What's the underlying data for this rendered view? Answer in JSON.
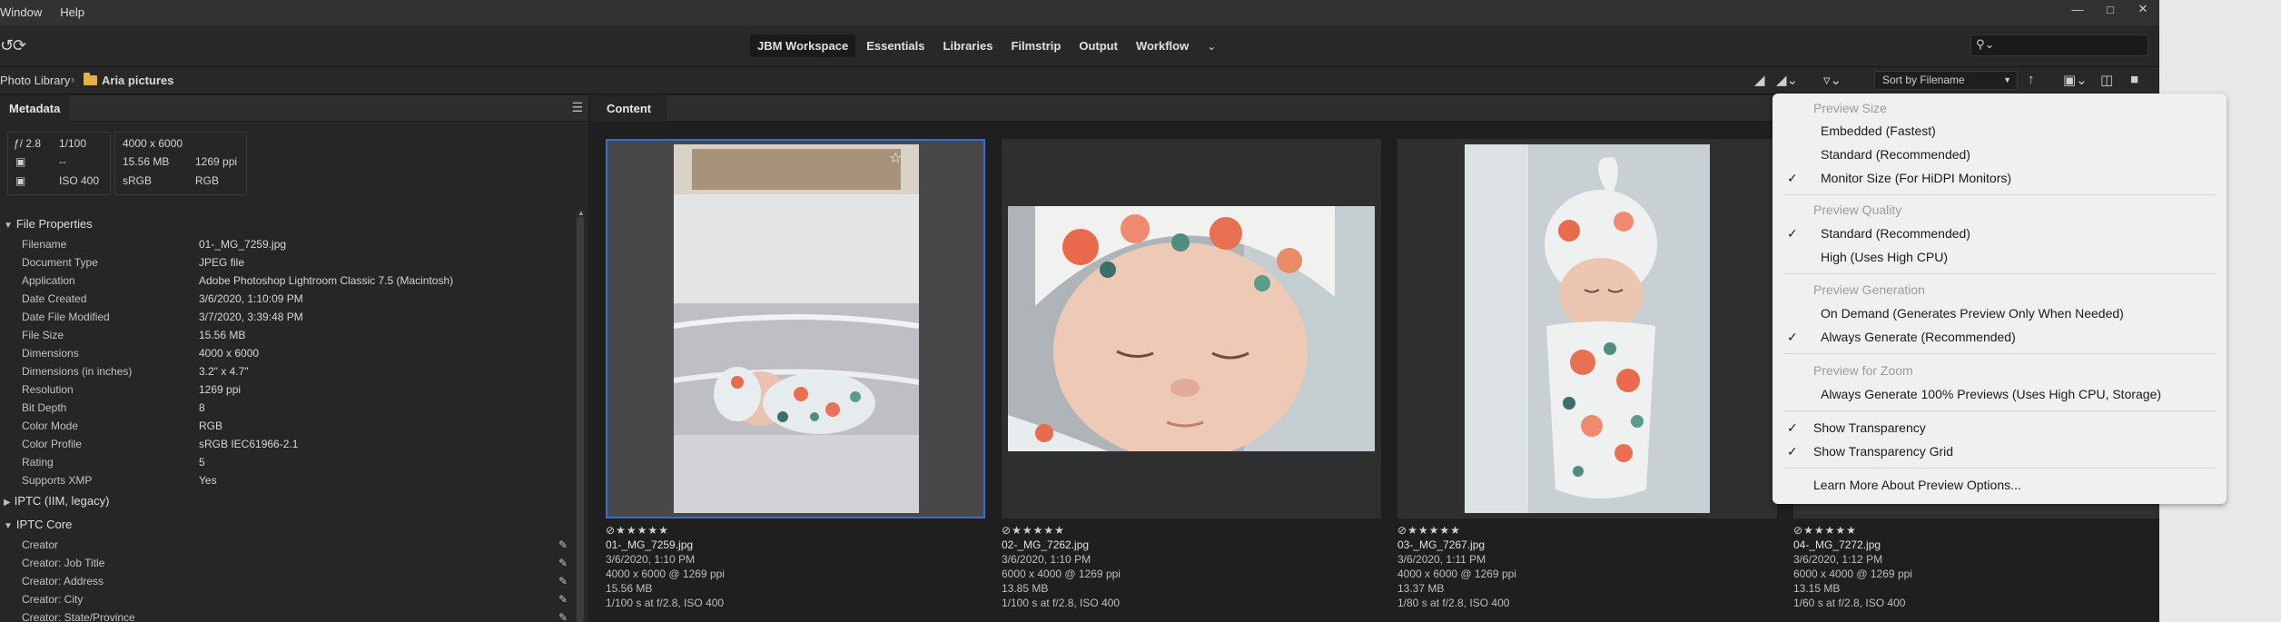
{
  "menu": [
    "Window",
    "Help"
  ],
  "workspaces": [
    "JBM Workspace",
    "Essentials",
    "Libraries",
    "Filmstrip",
    "Output",
    "Workflow"
  ],
  "active_workspace": "JBM Workspace",
  "search": {
    "value": "",
    "placeholder": ""
  },
  "path": {
    "root": "Photo Library",
    "folder": "Aria pictures"
  },
  "sort": {
    "label": "Sort by Filename"
  },
  "metadata_panel": {
    "tab": "Metadata",
    "quick": {
      "aperture": "ƒ/ 2.8",
      "shutter": "1/100",
      "exposure": "--",
      "iso": "ISO 400",
      "dimensions": "4000 x 6000",
      "filesize": "15.56 MB",
      "resolution": "1269 ppi",
      "colorspace": "sRGB",
      "colormode": "RGB"
    },
    "file_properties_title": "File Properties",
    "file_properties": [
      {
        "label": "Filename",
        "value": "01-_MG_7259.jpg"
      },
      {
        "label": "Document Type",
        "value": "JPEG file"
      },
      {
        "label": "Application",
        "value": "Adobe Photoshop Lightroom Classic 7.5 (Macintosh)"
      },
      {
        "label": "Date Created",
        "value": "3/6/2020, 1:10:09 PM"
      },
      {
        "label": "Date File Modified",
        "value": "3/7/2020, 3:39:48 PM"
      },
      {
        "label": "File Size",
        "value": "15.56 MB"
      },
      {
        "label": "Dimensions",
        "value": "4000 x 6000"
      },
      {
        "label": "Dimensions (in inches)",
        "value": "3.2\" x 4.7\""
      },
      {
        "label": "Resolution",
        "value": "1269 ppi"
      },
      {
        "label": "Bit Depth",
        "value": "8"
      },
      {
        "label": "Color Mode",
        "value": "RGB"
      },
      {
        "label": "Color Profile",
        "value": "sRGB IEC61966-2.1"
      },
      {
        "label": "Rating",
        "value": "5"
      },
      {
        "label": "Supports XMP",
        "value": "Yes"
      }
    ],
    "iptc_legacy_title": "IPTC (IIM, legacy)",
    "iptc_core_title": "IPTC Core",
    "iptc_core": [
      "Creator",
      "Creator: Job Title",
      "Creator: Address",
      "Creator: City",
      "Creator: State/Province"
    ]
  },
  "content_panel": {
    "tab": "Content",
    "items": [
      {
        "rating": "★★★★★",
        "name": "01-_MG_7259.jpg",
        "date": "3/6/2020, 1:10 PM",
        "dims": "4000 x 6000 @ 1269 ppi",
        "size": "15.56 MB",
        "exposure": "1/100 s at f/2.8, ISO 400"
      },
      {
        "rating": "★★★★★",
        "name": "02-_MG_7262.jpg",
        "date": "3/6/2020, 1:10 PM",
        "dims": "6000 x 4000 @ 1269 ppi",
        "size": "13.85 MB",
        "exposure": "1/100 s at f/2.8, ISO 400"
      },
      {
        "rating": "★★★★★",
        "name": "03-_MG_7267.jpg",
        "date": "3/6/2020, 1:11 PM",
        "dims": "4000 x 6000 @ 1269 ppi",
        "size": "13.37 MB",
        "exposure": "1/80 s at f/2.8, ISO 400"
      },
      {
        "rating": "★★★★★",
        "name": "04-_MG_7272.jpg",
        "date": "3/6/2020, 1:12 PM",
        "dims": "6000 x 4000 @ 1269 ppi",
        "size": "13.15 MB",
        "exposure": "1/60 s at f/2.8, ISO 400"
      }
    ]
  },
  "preview_menu": {
    "size_heading": "Preview Size",
    "size_options": [
      "Embedded (Fastest)",
      "Standard (Recommended)",
      "Monitor Size (For HiDPI Monitors)"
    ],
    "size_checked": "Monitor Size (For HiDPI Monitors)",
    "quality_heading": "Preview Quality",
    "quality_options": [
      "Standard (Recommended)",
      "High (Uses High CPU)"
    ],
    "quality_checked": "Standard (Recommended)",
    "generation_heading": "Preview Generation",
    "generation_options": [
      "On Demand (Generates Preview Only When Needed)",
      "Always Generate (Recommended)"
    ],
    "generation_checked": "Always Generate (Recommended)",
    "zoom_heading": "Preview for Zoom",
    "zoom_options": [
      "Always Generate 100% Previews (Uses High CPU, Storage)"
    ],
    "show_transparency": "Show Transparency",
    "show_transparency_grid": "Show Transparency Grid",
    "learn_more": "Learn More About Preview Options..."
  },
  "colors": {
    "accent": "#2f6fd6",
    "folder": "#e2b24a",
    "app_bg": "#1e1e1e",
    "menu_bg": "#f0f0f0"
  }
}
